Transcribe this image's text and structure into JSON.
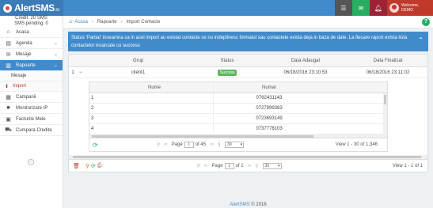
{
  "brand": {
    "name_a": "Alert",
    "name_b": "SMS",
    "suffix": ".ro"
  },
  "topbar": {
    "welcome": "Welcome,",
    "user": "DEMO"
  },
  "sidebar": {
    "credit": "Credit: 20 SMS",
    "pending": "SMS pending: 0",
    "items": [
      {
        "label": "Acasa",
        "icon": "home-icon"
      },
      {
        "label": "Agenda",
        "icon": "book-icon"
      },
      {
        "label": "Mesaje",
        "icon": "envelope-icon"
      },
      {
        "label": "Rapoarte",
        "icon": "chart-icon"
      },
      {
        "label": "Campanii",
        "icon": "calendar-icon"
      },
      {
        "label": "Monitorizare IP",
        "icon": "video-icon"
      },
      {
        "label": "Facturile Mele",
        "icon": "invoice-icon"
      },
      {
        "label": "Cumpara Credite",
        "icon": "cart-icon"
      }
    ],
    "sub_items": [
      {
        "label": "Mesaje"
      },
      {
        "label": "Import"
      }
    ]
  },
  "breadcrumb": {
    "home": "Acasa",
    "reports": "Rapoarte",
    "current": "Import Contacte"
  },
  "banner": {
    "text": "Status 'Partial' inseamna ca in acel import au existat contacte ce nu indeplinesc formatul sau contactele exista deja in baza de date. La fiecare raport exista lista contactelor incarcate cu success"
  },
  "grid": {
    "columns": [
      "Grup",
      "Status",
      "Data Adaugat",
      "Data Finalizat"
    ],
    "row": {
      "num": "1",
      "grup": "client1",
      "status": "Success",
      "added": "06/18/2016 23:10:53",
      "finished": "06/18/2016 23:11:02"
    }
  },
  "subgrid": {
    "columns": [
      "Nume",
      "Numar"
    ],
    "rows": [
      {
        "n": "1",
        "nume": "",
        "numar": "0762431143"
      },
      {
        "n": "2",
        "nume": "",
        "numar": "0727999383"
      },
      {
        "n": "3",
        "nume": "",
        "numar": "0723693149"
      },
      {
        "n": "4",
        "nume": "",
        "numar": "0737778103"
      }
    ],
    "pager": {
      "page_label": "Page",
      "page": "1",
      "of": "of 45",
      "per_page": "30",
      "view": "View 1 - 30 of 1,346"
    }
  },
  "footer_pager": {
    "page_label": "Page",
    "page": "1",
    "of": "of 1",
    "per_page": "30",
    "view": "View 1 - 1 of 1"
  },
  "copyright": {
    "brand_a": "Alert",
    "brand_b": "SMS",
    "text": "© 2016"
  },
  "colors": {
    "primary": "#428bca",
    "success": "#5cb85c",
    "danger": "#c0392b"
  }
}
